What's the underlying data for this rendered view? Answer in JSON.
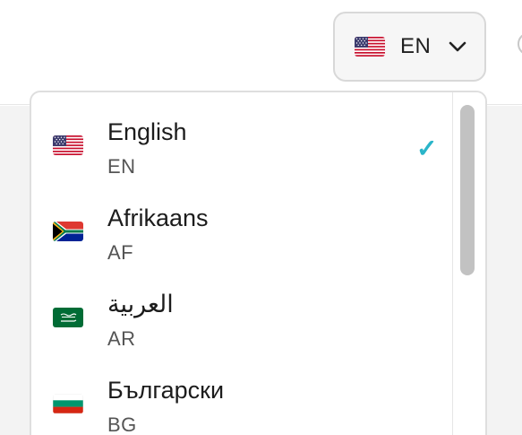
{
  "language_button": {
    "code": "EN",
    "flag_icon": "us-flag-icon",
    "chevron_icon": "chevron-down-icon"
  },
  "dropdown": {
    "items": [
      {
        "name": "English",
        "code": "EN",
        "flag_icon": "us-flag-icon",
        "selected": true,
        "check": "✓"
      },
      {
        "name": "Afrikaans",
        "code": "AF",
        "flag_icon": "south-africa-flag-icon",
        "selected": false
      },
      {
        "name": "العربية",
        "code": "AR",
        "flag_icon": "saudi-arabia-flag-icon",
        "selected": false
      },
      {
        "name": "Български",
        "code": "BG",
        "flag_icon": "bulgaria-flag-icon",
        "selected": false
      }
    ]
  },
  "colors": {
    "check_accent": "#2ab5c9",
    "scroll_thumb": "#c2c2c2"
  }
}
